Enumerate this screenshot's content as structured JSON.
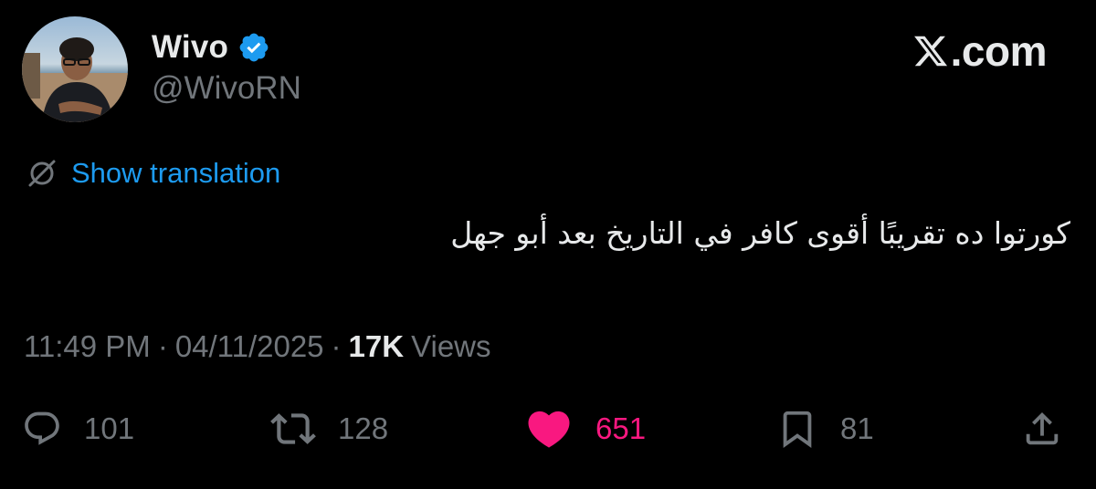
{
  "author": {
    "display_name": "Wivo",
    "handle": "@WivoRN",
    "verified": true
  },
  "brand": {
    "name": ".com",
    "logo_icon": "x-logo-icon"
  },
  "translation": {
    "label": "Show translation",
    "icon": "globe-off-icon"
  },
  "tweet": {
    "text": "كورتوا ده تقريبًا أقوى كافر في التاريخ بعد أبو جهل"
  },
  "meta": {
    "time": "11:49 PM",
    "separator": "·",
    "date": "04/11/2025",
    "views_count": "17K",
    "views_label": "Views"
  },
  "actions": {
    "replies": "101",
    "reposts": "128",
    "likes": "651",
    "bookmarks": "81"
  },
  "colors": {
    "background": "#000000",
    "primary_text": "#e7e9ea",
    "secondary_text": "#71767b",
    "link_blue": "#1d9bf0",
    "like_pink": "#f91880"
  }
}
